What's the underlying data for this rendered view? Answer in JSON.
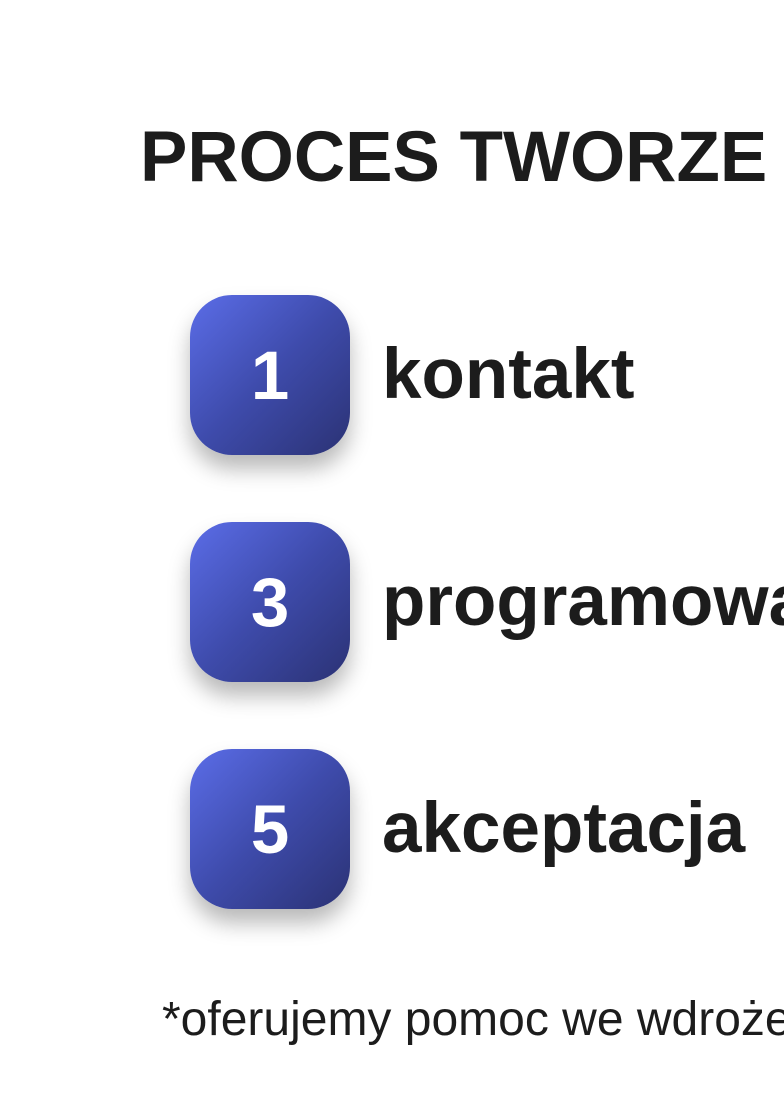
{
  "title": "PROCES TWORZE",
  "steps": [
    {
      "number": "1",
      "label": "kontakt"
    },
    {
      "number": "3",
      "label": "programowa"
    },
    {
      "number": "5",
      "label": "akceptacja"
    }
  ],
  "footnote": "*oferujemy pomoc we wdroże",
  "colors": {
    "badge_gradient_start": "#5b6de8",
    "badge_gradient_end": "#2b3274",
    "text": "#1c1c1c",
    "badge_text": "#ffffff",
    "background": "#ffffff"
  }
}
